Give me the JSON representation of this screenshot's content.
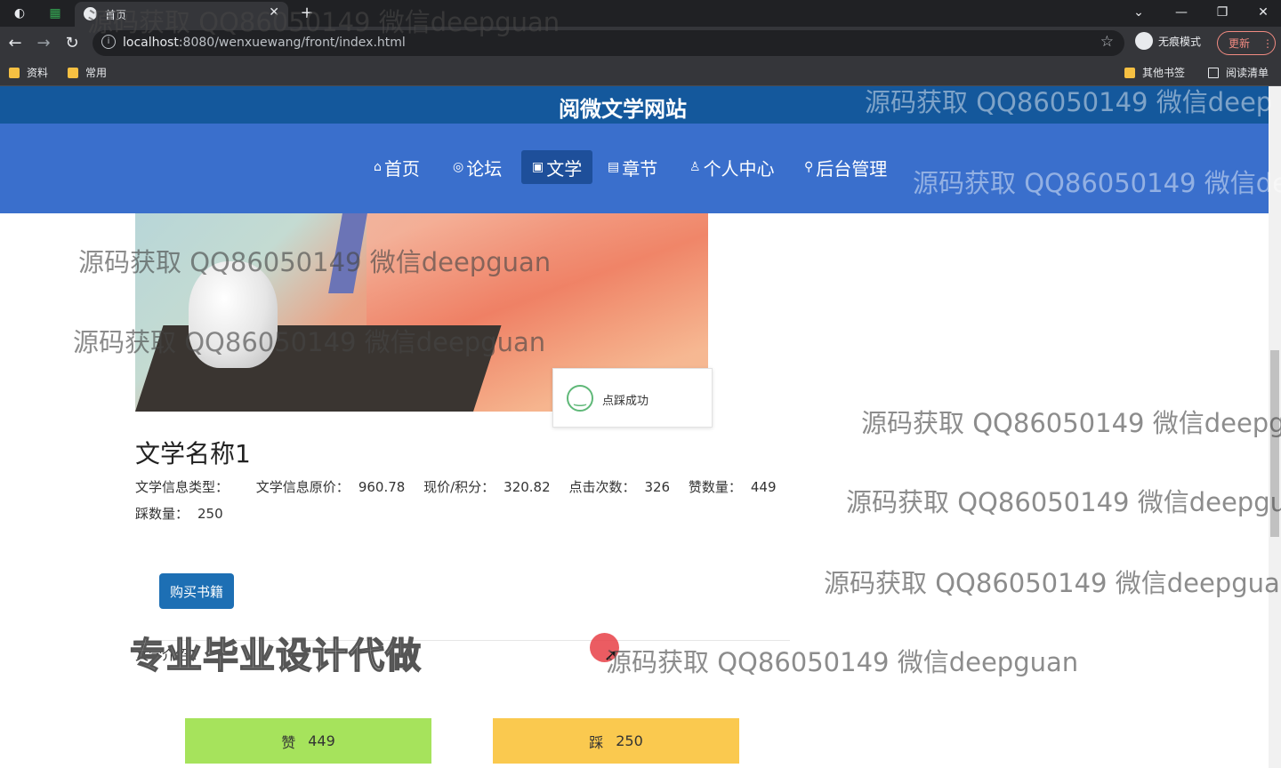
{
  "browser": {
    "tab_title": "首页",
    "url_host": "localhost",
    "url_path": ":8080/wenxuewang/front/index.html",
    "incognito_label": "无痕模式",
    "update_label": "更新",
    "bookmarks": [
      "资料",
      "常用"
    ],
    "bookmarks_right": [
      "其他书签",
      "阅读清单"
    ]
  },
  "site": {
    "title": "阅微文学网站",
    "nav": [
      {
        "icon": "⌂",
        "label": "首页"
      },
      {
        "icon": "◎",
        "label": "论坛"
      },
      {
        "icon": "▣",
        "label": "文学"
      },
      {
        "icon": "▤",
        "label": "章节"
      },
      {
        "icon": "♙",
        "label": "个人中心"
      },
      {
        "icon": "⚲",
        "label": "后台管理"
      }
    ],
    "active_nav": "文学"
  },
  "toast": {
    "message": "点踩成功"
  },
  "book": {
    "name": "文学名称1",
    "type_label": "文学信息类型：",
    "type_value": "",
    "original_price_label": "文学信息原价：",
    "original_price": "960.78",
    "current_price_label": "现价/积分：",
    "current_price": "320.82",
    "clicks_label": "点击次数：",
    "clicks": "326",
    "likes_label": "赞数量：",
    "likes": "449",
    "dislikes_label": "踩数量：",
    "dislikes": "250",
    "buy_label": "购买书籍",
    "intro": "文学介绍1"
  },
  "actions": {
    "like_label": "赞",
    "like_count": "449",
    "dislike_label": "踩",
    "dislike_count": "250"
  },
  "overlay": {
    "watermark": "源码获取 QQ86050149 微信deepguan",
    "watermark_cut_1": "源码获取 QQ86050149 微信deep",
    "watermark_cut_2": "源码获取 QQ86050149 微信de",
    "watermark_cut_3": "源码获取 QQ86050149 微信deepg",
    "watermark_cut_4": "源码获取 QQ86050149 微信deepgu",
    "watermark_cut_5": "源码获取 QQ86050149 微信deepgua",
    "stamp": "专业毕业设计代做"
  },
  "colors": {
    "header_top": "#14589c",
    "header_nav": "#3a6fcc",
    "nav_active": "#1e4f9a",
    "buy_button": "#1d6fb4",
    "like_button": "#a6e35c",
    "dislike_button": "#fac94f"
  }
}
